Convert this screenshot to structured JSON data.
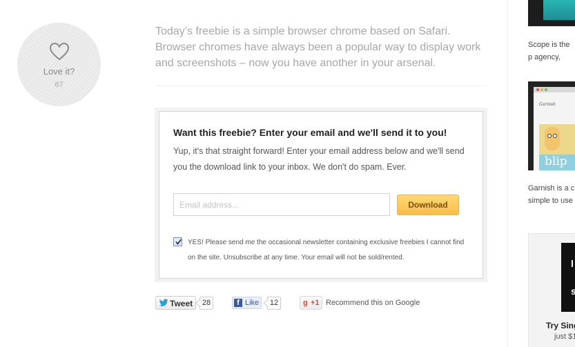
{
  "love": {
    "label": "Love it?",
    "count": "67",
    "icon": "heart-icon"
  },
  "article": {
    "intro": "Today’s freebie is a simple browser chrome based on Safari. Browser chromes have always been a popular way to display work and screenshots – now you have another in your arsenal."
  },
  "freebie": {
    "title": "Want this freebie? Enter your email and we'll send it to you!",
    "description": "Yup, it's that straight forward! Enter your email address below and we'll send you the download link to your inbox. We don't do spam. Ever.",
    "email_placeholder": "Email address...",
    "email_value": "",
    "download_label": "Download",
    "newsletter_checked": true,
    "newsletter_text": "YES! Please send me the occasional newsletter containing exclusive freebies I cannot find on the site. Unsubscribe at any time. Your email will not be sold/rented."
  },
  "share": {
    "tweet_label": "Tweet",
    "tweet_count": "28",
    "like_label": "Like",
    "like_count": "12",
    "gplus_label": "+1",
    "gplus_text": "Recommend this on Google"
  },
  "sidebar": {
    "item1_text": "Scope is the p agency, freela",
    "item2_text": "Garnish is a c simple to use p",
    "ad_title": "Try Sing",
    "ad_sub": "just $1"
  },
  "colors": {
    "accent": "#f7bd48",
    "facebook": "#3b5998",
    "gplus": "#dd4b39",
    "twitter": "#2e9fd4"
  }
}
